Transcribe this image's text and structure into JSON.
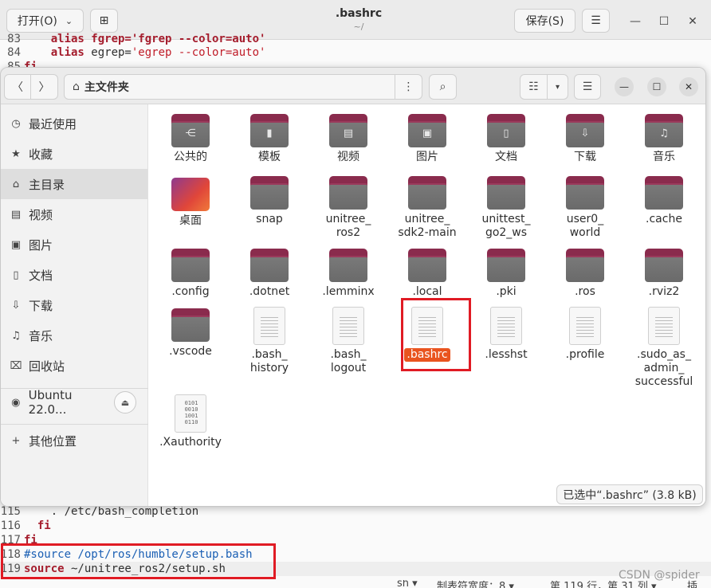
{
  "editor": {
    "open_label": "打开(O)",
    "title": ".bashrc",
    "subtitle": "~/",
    "save_label": "保存(S)",
    "lines_top": [
      {
        "num": "83",
        "text": "    alias fgrep='fgrep --color=auto'"
      },
      {
        "num": "84",
        "kw": "    alias",
        "text": " egrep=",
        "str": "'egrep --color=auto'"
      },
      {
        "num": "85",
        "kw": "fi"
      }
    ],
    "lines_bottom": [
      {
        "num": "115",
        "text": "    . /etc/bash_completion"
      },
      {
        "num": "116",
        "kw": "  fi"
      },
      {
        "num": "117",
        "kw": "fi"
      },
      {
        "num": "118",
        "cmt": "#source /opt/ros/humble/setup.bash"
      },
      {
        "num": "119",
        "kw": "source",
        "text": " ~/unitree_ros2/setup.sh"
      }
    ],
    "status": {
      "lang": "sh ▾",
      "tab_width": "制表符宽度：8 ▾",
      "position": "第 119 行，第 31 列 ▾",
      "insert": "插"
    },
    "watermark": "CSDN @spider"
  },
  "file_manager": {
    "path_label": "主文件夹",
    "sidebar": [
      {
        "icon": "clock-icon",
        "label": "最近使用"
      },
      {
        "icon": "star-icon",
        "label": "收藏"
      },
      {
        "icon": "home-icon",
        "label": "主目录",
        "active": true
      },
      {
        "icon": "video-icon",
        "label": "视频"
      },
      {
        "icon": "image-icon",
        "label": "图片"
      },
      {
        "icon": "document-icon",
        "label": "文档"
      },
      {
        "icon": "download-icon",
        "label": "下载"
      },
      {
        "icon": "music-icon",
        "label": "音乐"
      },
      {
        "icon": "trash-icon",
        "label": "回收站"
      }
    ],
    "device_label": "Ubuntu 22.0...",
    "other_locations_label": "其他位置",
    "items": [
      {
        "label": "公共的",
        "type": "folder",
        "emblem": "share-icon"
      },
      {
        "label": "模板",
        "type": "folder",
        "emblem": "template-icon"
      },
      {
        "label": "视频",
        "type": "folder",
        "emblem": "video-icon"
      },
      {
        "label": "图片",
        "type": "folder",
        "emblem": "image-icon"
      },
      {
        "label": "文档",
        "type": "folder",
        "emblem": "document-icon"
      },
      {
        "label": "下载",
        "type": "folder",
        "emblem": "download-icon"
      },
      {
        "label": "音乐",
        "type": "folder",
        "emblem": "music-icon"
      },
      {
        "label": "桌面",
        "type": "desktop"
      },
      {
        "label": "snap",
        "type": "folder"
      },
      {
        "label": "unitree_\nros2",
        "type": "folder"
      },
      {
        "label": "unitree_\nsdk2-main",
        "type": "folder"
      },
      {
        "label": "unittest_\ngo2_ws",
        "type": "folder"
      },
      {
        "label": "user0_\nworld",
        "type": "folder"
      },
      {
        "label": ".cache",
        "type": "folder"
      },
      {
        "label": ".config",
        "type": "folder"
      },
      {
        "label": ".dotnet",
        "type": "folder"
      },
      {
        "label": ".lemminx",
        "type": "folder"
      },
      {
        "label": ".local",
        "type": "folder"
      },
      {
        "label": ".pki",
        "type": "folder"
      },
      {
        "label": ".ros",
        "type": "folder"
      },
      {
        "label": ".rviz2",
        "type": "folder"
      },
      {
        "label": ".vscode",
        "type": "folder"
      },
      {
        "label": ".bash_\nhistory",
        "type": "file"
      },
      {
        "label": ".bash_\nlogout",
        "type": "file"
      },
      {
        "label": ".bashrc",
        "type": "file",
        "selected": true
      },
      {
        "label": ".lesshst",
        "type": "file"
      },
      {
        "label": ".profile",
        "type": "file"
      },
      {
        "label": ".sudo_as_\nadmin_\nsuccessful",
        "type": "file"
      },
      {
        "label": ".Xauthority",
        "type": "binary"
      }
    ],
    "status": "已选中“.bashrc” (3.8 kB)"
  }
}
